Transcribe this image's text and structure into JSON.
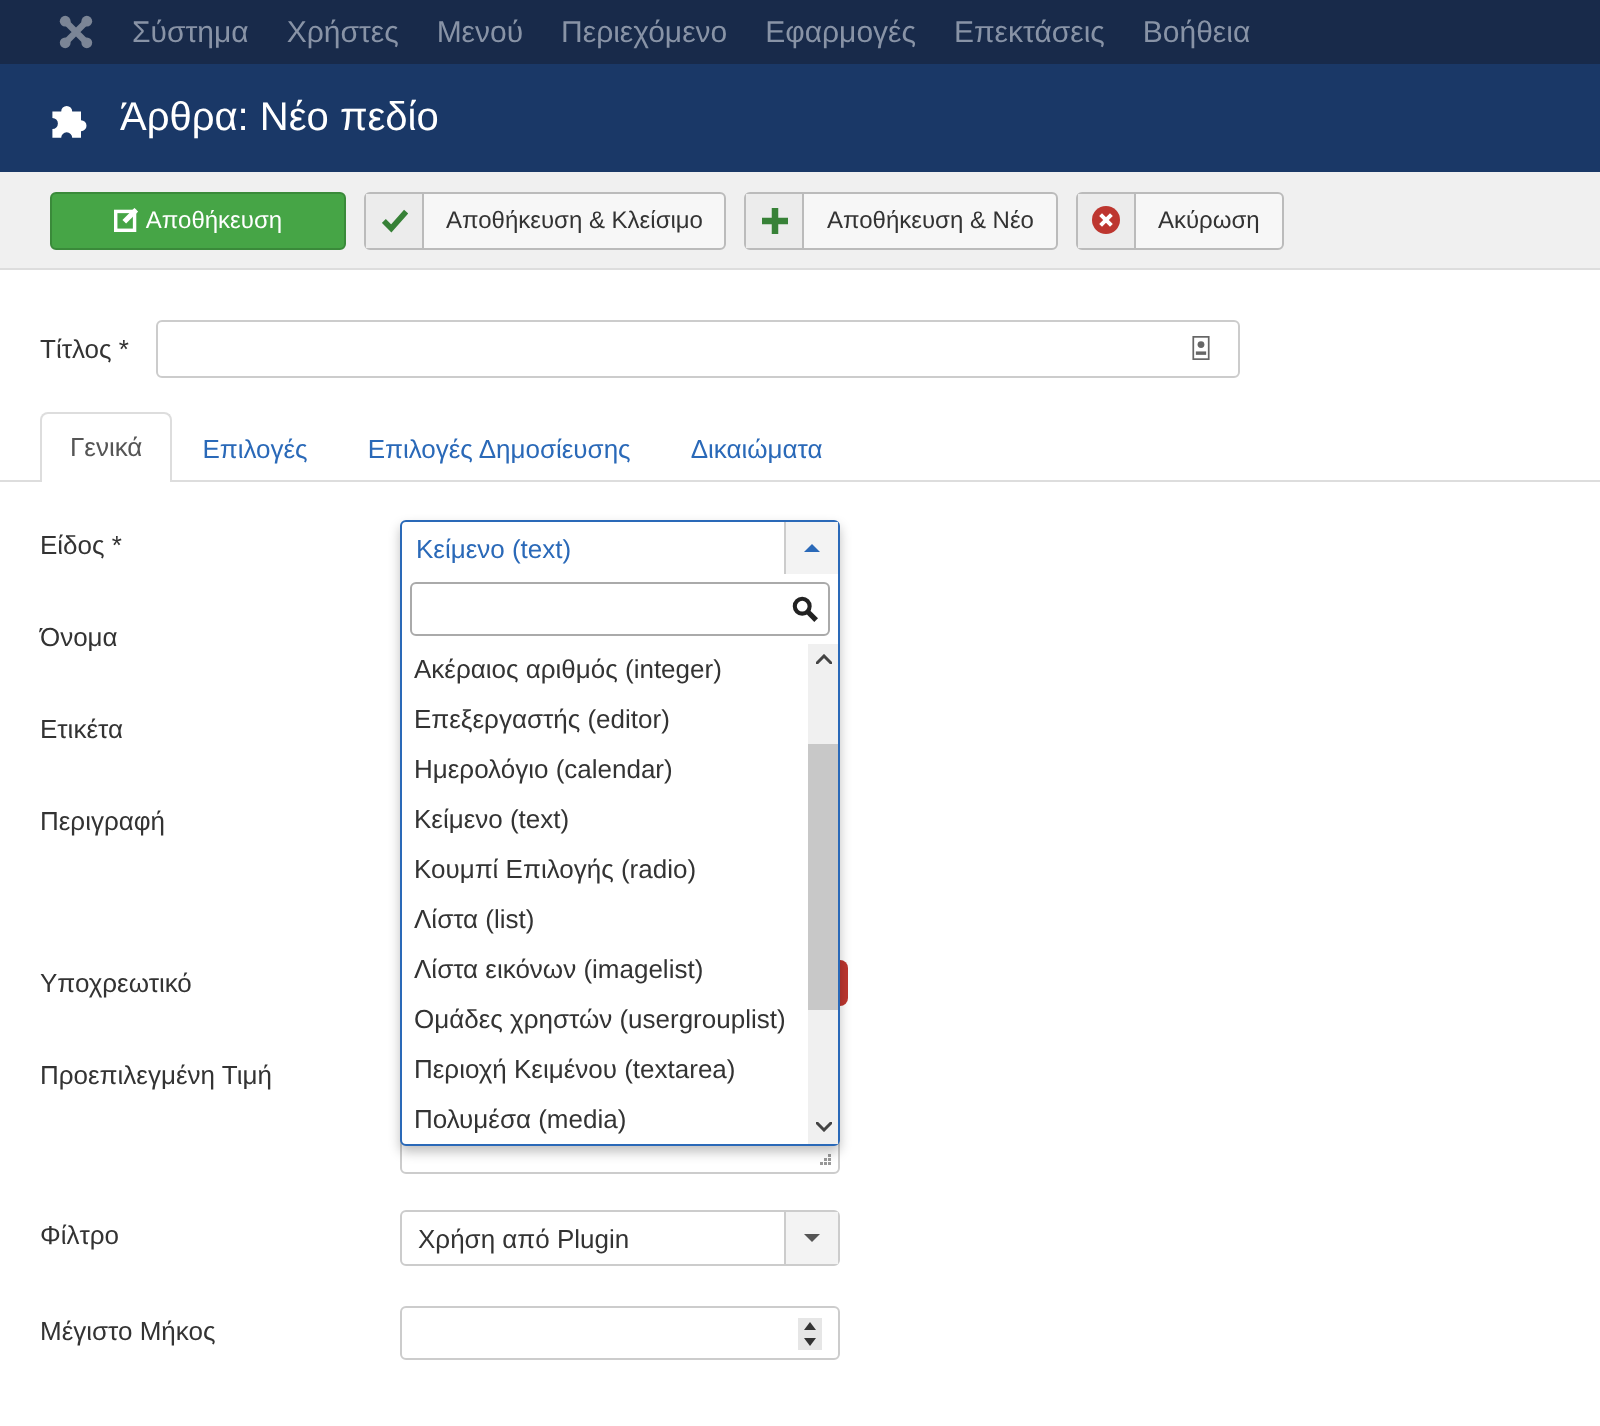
{
  "menu": [
    "Σύστημα",
    "Χρήστες",
    "Μενού",
    "Περιεχόμενο",
    "Εφαρμογές",
    "Επεκτάσεις",
    "Βοήθεια"
  ],
  "header": {
    "title": "Άρθρα: Νέο πεδίο"
  },
  "toolbar": [
    {
      "kind": "save",
      "label": "Αποθήκευση"
    },
    {
      "kind": "check",
      "label": "Αποθήκευση & Κλείσιμο"
    },
    {
      "kind": "plus",
      "label": "Αποθήκευση & Νέο"
    },
    {
      "kind": "cancel",
      "label": "Ακύρωση"
    }
  ],
  "title_field": {
    "label": "Τίτλος *"
  },
  "tabs": [
    {
      "label": "Γενικά",
      "selected": true
    },
    {
      "label": "Επιλογές",
      "selected": false
    },
    {
      "label": "Επιλογές Δημοσίευσης",
      "selected": false
    },
    {
      "label": "Δικαιώματα",
      "selected": false
    }
  ],
  "fields": [
    {
      "label": "Είδος *",
      "kind": "dropdown",
      "value": "Κείμενο (text)",
      "expanded": true,
      "options": [
        "Ακέραιος αριθμός (integer)",
        "Επεξεργαστής (editor)",
        "Ημερολόγιο (calendar)",
        "Κείμενο (text)",
        "Κουμπί Επιλογής (radio)",
        "Λίστα (list)",
        "Λίστα εικόνων (imagelist)",
        "Ομάδες χρηστών (usergrouplist)",
        "Περιοχή Κειμένου (textarea)",
        "Πολυμέσα (media)"
      ]
    },
    {
      "label": "Όνομα",
      "kind": "covered"
    },
    {
      "label": "Ετικέτα",
      "kind": "covered"
    },
    {
      "label": "Περιγραφή",
      "kind": "covered-area"
    },
    {
      "label": "Υποχρεωτικό",
      "kind": "toggle"
    },
    {
      "label": "Προεπιλεγμένη Τιμή",
      "kind": "textarea"
    },
    {
      "label": "Φίλτρο",
      "kind": "select",
      "value": "Χρήση από Plugin"
    },
    {
      "label": "Μέγιστο Μήκος",
      "kind": "number"
    }
  ]
}
